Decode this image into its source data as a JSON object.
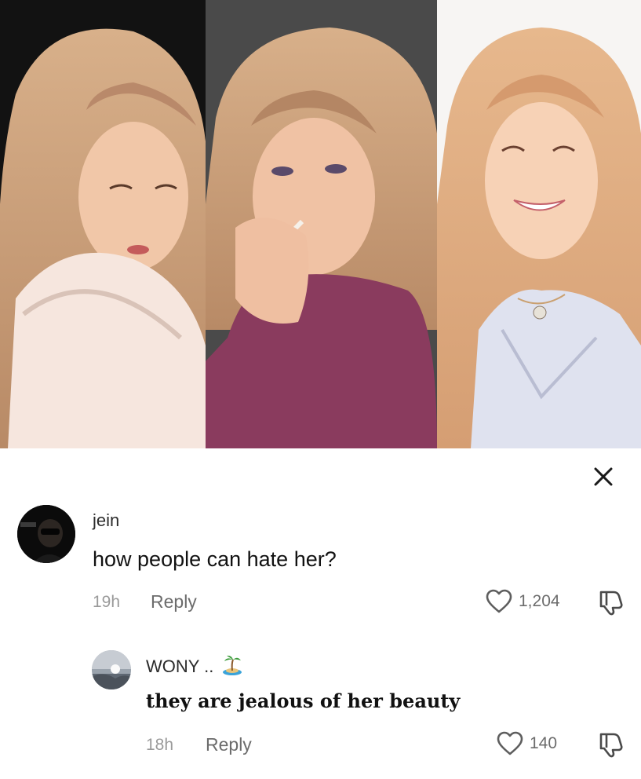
{
  "comments": [
    {
      "username": "jein",
      "text": "how people can hate her?",
      "time": "19h",
      "reply_label": "Reply",
      "likes": "1,204"
    },
    {
      "username": "WONY ..",
      "username_emoji": "island-emoji",
      "text": "they are jealous of her beauty",
      "time": "18h",
      "reply_label": "Reply",
      "likes": "140"
    }
  ],
  "icons": {
    "close": "close-icon",
    "like": "heart-outline-icon",
    "dislike": "thumbs-down-icon"
  },
  "colors": {
    "panel_left_bg": "#121212",
    "panel_mid_bg": "#4a4a4a",
    "panel_right_bg": "#f7f5f3",
    "hair": "#c9a07a",
    "text_primary": "#111111",
    "text_secondary": "#6c6c6c"
  }
}
